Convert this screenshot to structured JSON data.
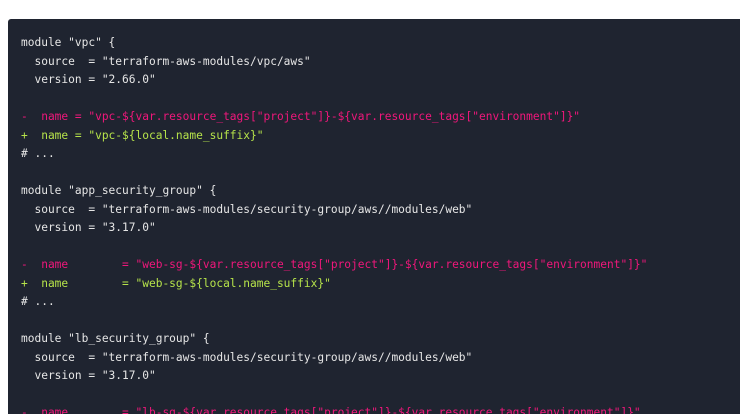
{
  "colors": {
    "panel_background": "#1f2430",
    "plain_text": "#e6e6e6",
    "removed_line": "#f0177b",
    "added_line": "#b6e34a"
  },
  "code": {
    "lines": [
      {
        "type": "plain",
        "text": "module \"vpc\" {"
      },
      {
        "type": "plain",
        "text": "  source  = \"terraform-aws-modules/vpc/aws\""
      },
      {
        "type": "plain",
        "text": "  version = \"2.66.0\""
      },
      {
        "type": "plain",
        "text": ""
      },
      {
        "type": "removed",
        "text": "-  name = \"vpc-${var.resource_tags[\"project\"]}-${var.resource_tags[\"environment\"]}\""
      },
      {
        "type": "added",
        "text": "+  name = \"vpc-${local.name_suffix}\""
      },
      {
        "type": "comment",
        "text": "# ..."
      },
      {
        "type": "plain",
        "text": ""
      },
      {
        "type": "plain",
        "text": "module \"app_security_group\" {"
      },
      {
        "type": "plain",
        "text": "  source  = \"terraform-aws-modules/security-group/aws//modules/web\""
      },
      {
        "type": "plain",
        "text": "  version = \"3.17.0\""
      },
      {
        "type": "plain",
        "text": ""
      },
      {
        "type": "removed",
        "text": "-  name        = \"web-sg-${var.resource_tags[\"project\"]}-${var.resource_tags[\"environment\"]}\""
      },
      {
        "type": "added",
        "text": "+  name        = \"web-sg-${local.name_suffix}\""
      },
      {
        "type": "comment",
        "text": "# ..."
      },
      {
        "type": "plain",
        "text": ""
      },
      {
        "type": "plain",
        "text": "module \"lb_security_group\" {"
      },
      {
        "type": "plain",
        "text": "  source  = \"terraform-aws-modules/security-group/aws//modules/web\""
      },
      {
        "type": "plain",
        "text": "  version = \"3.17.0\""
      },
      {
        "type": "plain",
        "text": ""
      },
      {
        "type": "removed",
        "text": "-  name        = \"lb-sg-${var.resource_tags[\"project\"]}-${var.resource_tags[\"environment\"]}\""
      }
    ]
  }
}
